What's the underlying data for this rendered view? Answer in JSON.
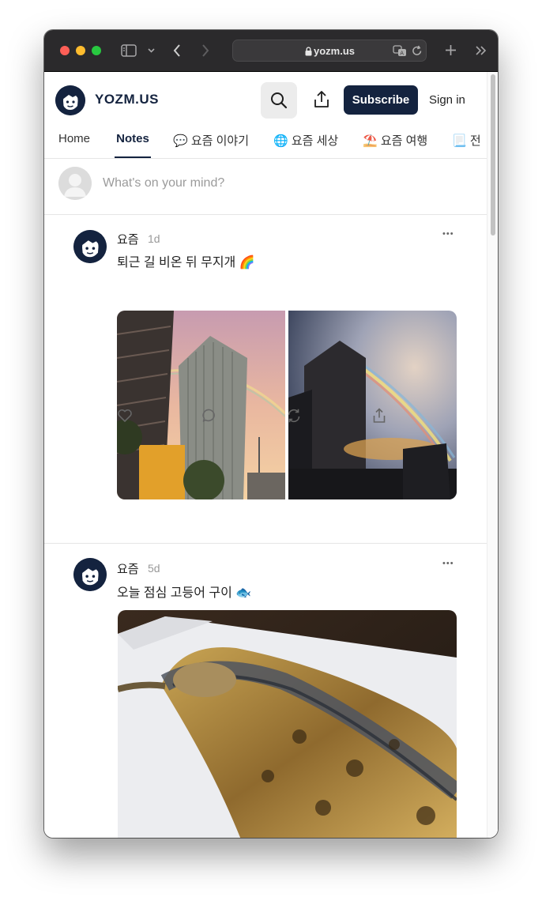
{
  "browser": {
    "url": "yozm.us",
    "icons": [
      "sidebar-icon",
      "chevron-down-icon",
      "back-icon",
      "forward-icon",
      "lock-icon",
      "translate-icon",
      "reload-icon",
      "new-tab-icon",
      "more-icon"
    ]
  },
  "header": {
    "logo": "YOZM.US",
    "subscribe_label": "Subscribe",
    "signin_label": "Sign in"
  },
  "tabs": [
    {
      "label": "Home"
    },
    {
      "label": "Notes"
    },
    {
      "emoji": "💬",
      "label": "요즘 이야기"
    },
    {
      "emoji": "🌐",
      "label": "요즘 세상"
    },
    {
      "emoji": "⛱️",
      "label": "요즘 여행"
    },
    {
      "emoji": "📃",
      "label": "전"
    }
  ],
  "composer": {
    "placeholder": "What's on your mind?"
  },
  "notes": [
    {
      "author": "요즘",
      "time": "1d",
      "more": "•••",
      "text": "퇴근 길 비온 뒤 무지개 🌈"
    },
    {
      "author": "요즘",
      "time": "5d",
      "more": "•••",
      "text": "오늘 점심 고등어 구이 🐟"
    }
  ],
  "colors": {
    "brand": "#14233f",
    "titlebar": "#2b2a2c"
  }
}
